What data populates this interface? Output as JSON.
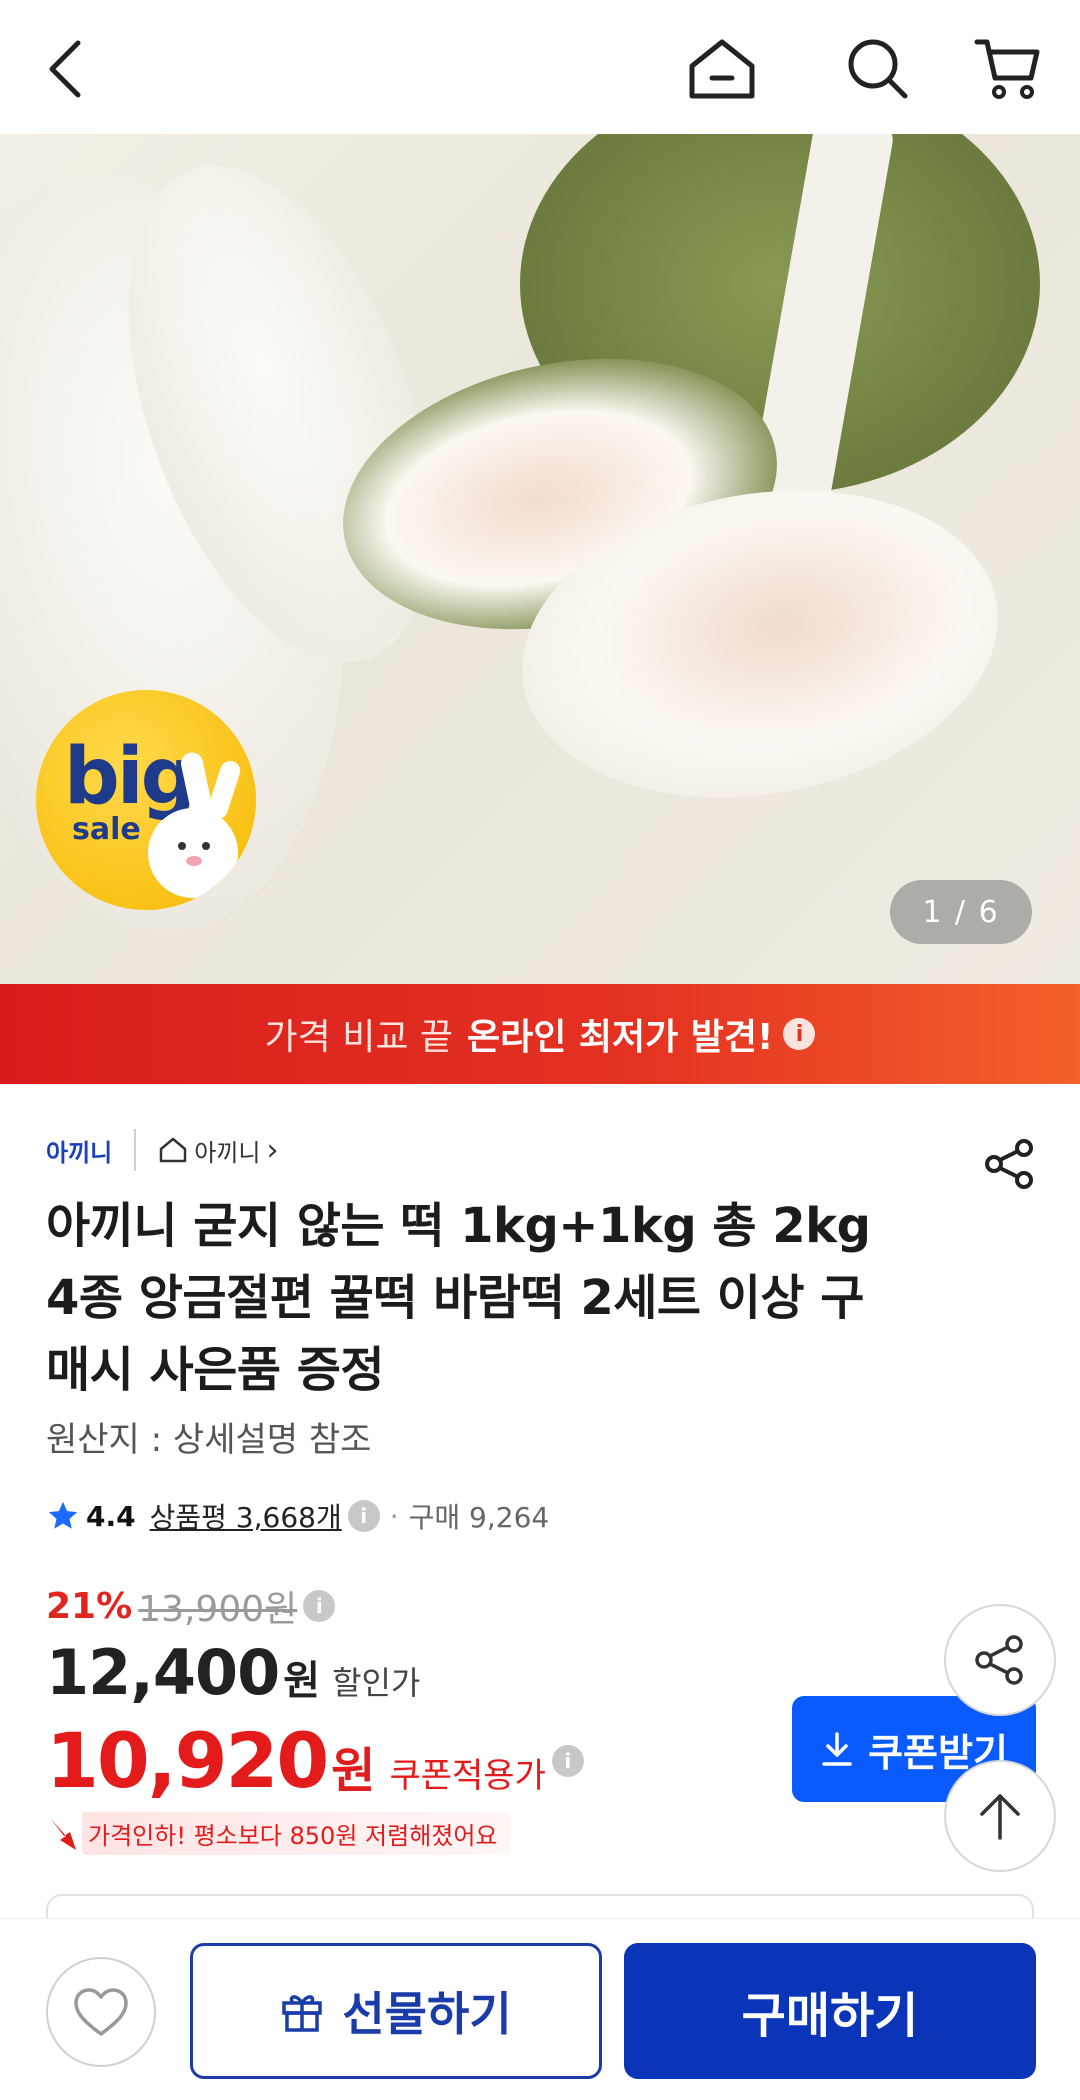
{
  "header": {
    "back_icon": "back-chevron-icon",
    "home_icon": "home-icon",
    "search_icon": "search-icon",
    "cart_icon": "cart-icon"
  },
  "hero": {
    "image_counter": "1 / 6",
    "badge_big": "big",
    "badge_sale": "sale"
  },
  "banner": {
    "prefix": "가격 비교 끝",
    "highlight": "온라인 최저가 발견!",
    "info_icon": "i"
  },
  "product": {
    "brand": "아끼니",
    "store": "아끼니",
    "store_chevron": "›",
    "title": "아끼니 굳지 않는 떡 1kg+1kg 총 2kg 4종 앙금절편 꿀떡 바람떡 2세트 이상 구매시 사은품 증정",
    "origin": "원산지 : 상세설명 참조",
    "rating_score": "4.4",
    "reviews": "상품평 3,668개",
    "info_icon": "i",
    "purchase_count": "구매 9,264",
    "discount_percent": "21%",
    "original_price": "13,900원",
    "sale_price": "12,400",
    "sale_unit": "원",
    "sale_label": "할인가",
    "coupon_price": "10,920",
    "coupon_unit": "원",
    "coupon_label": "쿠폰적용가",
    "price_drop_text": "가격인하! 평소보다 850원 저렴해졌어요"
  },
  "buttons": {
    "coupon": "쿠폰받기",
    "gift": "선물하기",
    "buy": "구매하기"
  },
  "colors": {
    "brand_blue": "#0a35b8",
    "coupon_blue": "#0a5bff",
    "price_red": "#e31b1b",
    "banner_red": "#d81c1c"
  }
}
